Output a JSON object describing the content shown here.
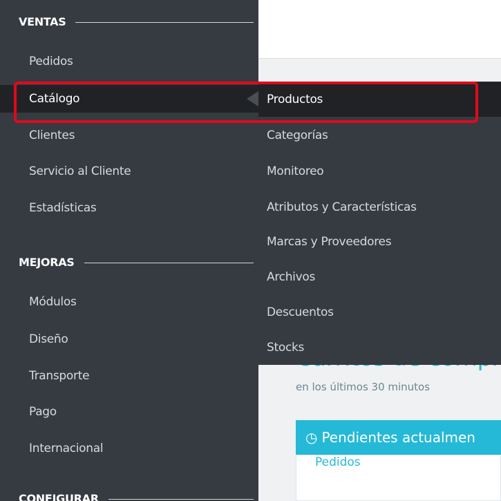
{
  "sidebar": {
    "sections": [
      {
        "title": "VENTAS"
      },
      {
        "title": "MEJORAS"
      },
      {
        "title": "CONFIGURAR"
      }
    ],
    "ventas_items": [
      "Pedidos",
      "Catálogo",
      "Clientes",
      "Servicio al Cliente",
      "Estadísticas"
    ],
    "mejoras_items": [
      "Módulos",
      "Diseño",
      "Transporte",
      "Pago",
      "Internacional"
    ],
    "active_item": "Catálogo"
  },
  "submenu": {
    "items": [
      "Productos",
      "Categorías",
      "Monitoreo",
      "Atributos y Características",
      "Marcas y Proveedores",
      "Archivos",
      "Descuentos",
      "Stocks"
    ],
    "active_item": "Productos"
  },
  "content": {
    "title_partial": "Carritos de compr",
    "subtitle": "en los últimos 30 minutos",
    "panel_title": "Pendientes actualmen",
    "panel_link": "Pedidos"
  },
  "colors": {
    "sidebar_bg": "#363a41",
    "active_bg": "#202226",
    "accent": "#25b9d7",
    "highlight": "#e0091b"
  },
  "icons": {
    "panel_icon": "clock-icon"
  }
}
